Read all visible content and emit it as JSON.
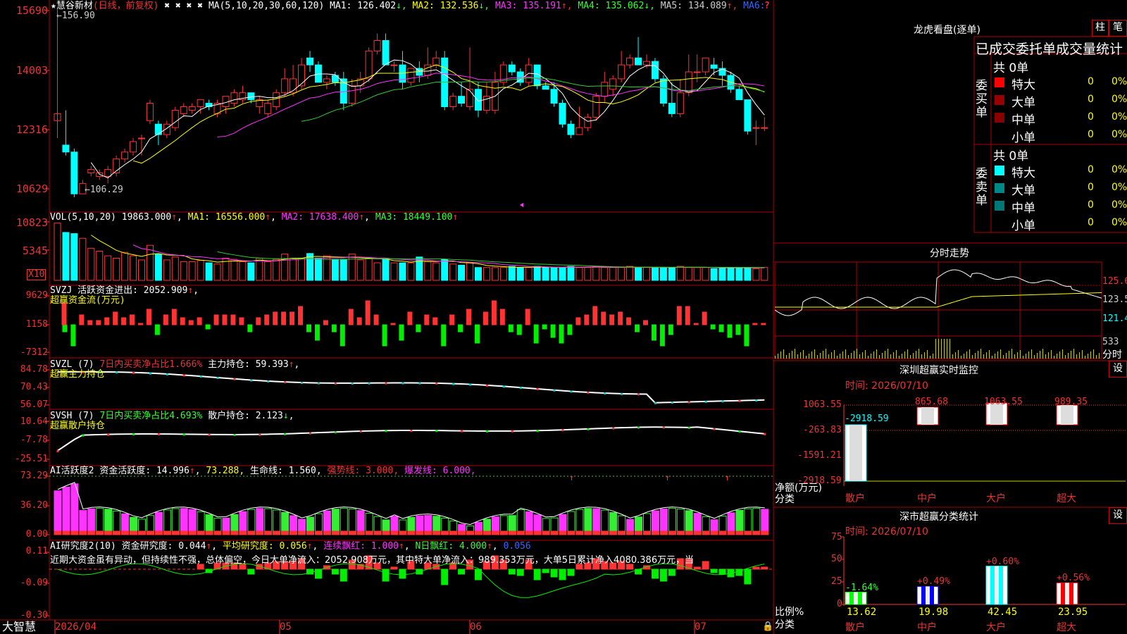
{
  "chart": {
    "stock_name": "慧谷新材",
    "period_note": "(日线，前复权)",
    "ma_header": "MA(5,10,20,30,60,120)",
    "ma_values": [
      {
        "label": "MA1: 126.402",
        "arrow": "↓",
        "color": "#ffffff"
      },
      {
        "label": "MA2: 132.536",
        "arrow": "↓",
        "color": "#ffff00"
      },
      {
        "label": "MA3: 135.191",
        "arrow": "↑",
        "color": "#ff33ff"
      },
      {
        "label": "MA4: 135.062",
        "arrow": "↓",
        "color": "#33ff33"
      },
      {
        "label": "MA5: 134.089",
        "arrow": "↑",
        "color": "#cccccc"
      },
      {
        "label": "MA6:",
        "arrow": "",
        "color": "#3366ff"
      }
    ],
    "high_note": "156.90",
    "low_note": "←106.29",
    "y_ticks": [
      "15690",
      "14003",
      "12316",
      "10629"
    ],
    "candles": [
      [
        125,
        127,
        120,
        128
      ],
      [
        118,
        116,
        115,
        128
      ],
      [
        116,
        104,
        103,
        117
      ],
      [
        104,
        107,
        104,
        108
      ],
      [
        110,
        111,
        109,
        112
      ],
      [
        109,
        110,
        108,
        111
      ],
      [
        109,
        111,
        107,
        112
      ],
      [
        110,
        114,
        109,
        115
      ],
      [
        114,
        116,
        113,
        117
      ],
      [
        116,
        119,
        115,
        120
      ],
      [
        120,
        120,
        115,
        121
      ],
      [
        125,
        130,
        124,
        131
      ],
      [
        124,
        121,
        118,
        125
      ],
      [
        121,
        124,
        120,
        125
      ],
      [
        123,
        128,
        122,
        129
      ],
      [
        127,
        129,
        126,
        130
      ],
      [
        128,
        129,
        127,
        130
      ],
      [
        129,
        131,
        127,
        131
      ],
      [
        130,
        129,
        128,
        131
      ],
      [
        127,
        130,
        126,
        131
      ],
      [
        129,
        132,
        127,
        132
      ],
      [
        130,
        133,
        129,
        134
      ],
      [
        131,
        133,
        130,
        135
      ],
      [
        133,
        131,
        130,
        133
      ],
      [
        129,
        131,
        127,
        132
      ],
      [
        127,
        130,
        126,
        131
      ],
      [
        129,
        133,
        128,
        134
      ],
      [
        133,
        137,
        132,
        140
      ],
      [
        133,
        137,
        132,
        141
      ],
      [
        135,
        141,
        134,
        143
      ],
      [
        143,
        141,
        139,
        145
      ],
      [
        141,
        136,
        136,
        142
      ],
      [
        136,
        137,
        134,
        138
      ],
      [
        138,
        136,
        135,
        139
      ],
      [
        137,
        130,
        128,
        139
      ],
      [
        130,
        135,
        129,
        137
      ],
      [
        135,
        137,
        133,
        139
      ],
      [
        137,
        145,
        136,
        146
      ],
      [
        145,
        148,
        144,
        150
      ],
      [
        148,
        141,
        141,
        150
      ],
      [
        141,
        141,
        139,
        142
      ],
      [
        141,
        136,
        134,
        145
      ],
      [
        136,
        140,
        135,
        140
      ],
      [
        140,
        138,
        136,
        142
      ],
      [
        138,
        141,
        137,
        146
      ],
      [
        141,
        143,
        140,
        145
      ],
      [
        143,
        129,
        128,
        145
      ],
      [
        129,
        132,
        128,
        133
      ],
      [
        132,
        130,
        129,
        136
      ],
      [
        129,
        134,
        128,
        146
      ],
      [
        134,
        128,
        126,
        136
      ],
      [
        128,
        132,
        127,
        136
      ],
      [
        128,
        136,
        127,
        139
      ],
      [
        136,
        141,
        135,
        142
      ],
      [
        141,
        139,
        138,
        142
      ],
      [
        139,
        136,
        135,
        140
      ],
      [
        136,
        141,
        135,
        143
      ],
      [
        141,
        135,
        134,
        141
      ],
      [
        135,
        134,
        134,
        136
      ],
      [
        134,
        130,
        129,
        136
      ],
      [
        130,
        124,
        123,
        131
      ],
      [
        124,
        121,
        120,
        125
      ],
      [
        121,
        123,
        121,
        129
      ],
      [
        123,
        126,
        122,
        127
      ],
      [
        126,
        132,
        125,
        133
      ],
      [
        132,
        136,
        130,
        139
      ],
      [
        134,
        137,
        132,
        138
      ],
      [
        137,
        141,
        136,
        145
      ],
      [
        141,
        143,
        140,
        144
      ],
      [
        143,
        141,
        141,
        149
      ],
      [
        141,
        142,
        140,
        144
      ],
      [
        142,
        137,
        136,
        143
      ],
      [
        137,
        130,
        129,
        138
      ],
      [
        130,
        127,
        126,
        136
      ],
      [
        127,
        133,
        126,
        137
      ],
      [
        133,
        139,
        132,
        144
      ],
      [
        139,
        139,
        136,
        144
      ],
      [
        139,
        143,
        138,
        143
      ],
      [
        141,
        140,
        138,
        143
      ],
      [
        140,
        138,
        135,
        142
      ],
      [
        138,
        134,
        133,
        139
      ],
      [
        134,
        131,
        131,
        135
      ],
      [
        131,
        122,
        121,
        131
      ],
      [
        123,
        123,
        118,
        125
      ],
      [
        123,
        123,
        122,
        126
      ]
    ],
    "bottom_dates": [
      "2026/04",
      "05",
      "06",
      "07"
    ],
    "brand": "大智慧"
  },
  "vol": {
    "header": "VOL(5,10,20)",
    "v": "19863.000",
    "ma1": "MA1: 16556.000",
    "ma2": "MA2: 17638.400",
    "ma3": "MA3: 18449.100",
    "y_ticks": [
      "10823",
      "5345"
    ],
    "unit": "X10",
    "bars": [
      0.98,
      0.82,
      0.8,
      0.72,
      0.55,
      0.5,
      0.42,
      0.38,
      0.48,
      0.42,
      0.35,
      0.6,
      0.45,
      0.35,
      0.4,
      0.32,
      0.32,
      0.34,
      0.3,
      0.28,
      0.38,
      0.36,
      0.32,
      0.3,
      0.38,
      0.32,
      0.36,
      0.45,
      0.38,
      0.38,
      0.46,
      0.38,
      0.42,
      0.36,
      0.36,
      0.45,
      0.35,
      0.38,
      0.3,
      0.36,
      0.3,
      0.3,
      0.3,
      0.4,
      0.32,
      0.3,
      0.36,
      0.28,
      0.26,
      0.3,
      0.22,
      0.22,
      0.22,
      0.22,
      0.24,
      0.22,
      0.22,
      0.24,
      0.22,
      0.22,
      0.22,
      0.24,
      0.22,
      0.22,
      0.24,
      0.22,
      0.22,
      0.22,
      0.24,
      0.22,
      0.22,
      0.22,
      0.22,
      0.22,
      0.24,
      0.22,
      0.22,
      0.22,
      0.2,
      0.22,
      0.22,
      0.22,
      0.22,
      0.2,
      0.22
    ]
  },
  "svzj": {
    "header": "SVZJ",
    "label": "活跃资金进出:",
    "value": "2052.909",
    "subtitle": "超赢资金流(万元)",
    "y_ticks": [
      "9629",
      "1158",
      "-7312"
    ]
  },
  "svzl": {
    "header": "SVZL (7)",
    "pct": "7日内买卖净占比1.666%",
    "hold": "主力持仓: 59.393",
    "subtitle": "超赢主力持仓",
    "y_ticks": [
      "84.78",
      "70.43",
      "56.07"
    ]
  },
  "svsh": {
    "header": "SVSH (7)",
    "pct": "7日内买卖净占比4.693%",
    "hold": "散户持仓: 2.123",
    "subtitle": "超赢散户持仓",
    "y_ticks": [
      "10.64",
      "-7.78",
      "-25.51"
    ]
  },
  "ai1": {
    "header": "AI活跃度2",
    "a": "资金活跃度: 14.996",
    "b": "73.288,",
    "c": "生命线: 1.560,",
    "d": "强势线: 3.000,",
    "e": "爆发线: 6.000,",
    "y_ticks": [
      "73.29",
      "36.20",
      "0.00"
    ]
  },
  "ai2": {
    "header": "AI研究度2(10)",
    "a": "资金研究度: 0.044",
    "b": "平均研究度: 0.056",
    "c": "连续飘红: 1.000",
    "d": "N日飘红: 4.000",
    "e": "0.056",
    "comment": "近期大资金虽有异动，但持续性不强，总体偏空，今日大单净流入：2052.908万元，其中特大单净流入：989.353万元，大单5日累计净入4080.386万元，当",
    "y_ticks": [
      "0.11",
      "-0.09",
      "-0.30"
    ]
  },
  "right": {
    "lhb_title": "龙虎看盘(逐单)",
    "btn1": "柱",
    "btn2": "笔",
    "tabs_title": "已成交委托单成交量统计",
    "buy_side": "委买单",
    "sell_side": "委卖单",
    "buy_total": "共 0单",
    "sell_total": "共 0单",
    "rows": [
      "特大",
      "大单",
      "中单",
      "小单"
    ],
    "zero": "0",
    "pct": "0%",
    "fenshi_title": "分时走势",
    "fenshi_y": [
      "125.6",
      "123.5",
      "121.4"
    ],
    "fenshi_vol": "533",
    "fenshi_unit": "分时",
    "sz_title": "深圳超赢实时监控",
    "sz_btn": "设",
    "sz_time": "时间: 2026/07/10",
    "sz_y": [
      "1063.55",
      "-263.83",
      "-1591.21",
      "-2918.59"
    ],
    "sz_bars": [
      {
        "label": "散户",
        "value": "-2918.59"
      },
      {
        "label": "中户",
        "value": "865.68"
      },
      {
        "label": "大户",
        "value": "1063.55"
      },
      {
        "label": "超大",
        "value": "989.35"
      }
    ],
    "sz_ylabel": "净额(万元)",
    "sz_xlabel": "分类",
    "cls_title": "深市超赢分类统计",
    "cls_btn": "设",
    "cls_time": "时间: 2026/07/10",
    "cls_y": [
      "75",
      "50",
      "25",
      "0"
    ],
    "cls_bars": [
      {
        "label": "散户",
        "pct": "-1.64%",
        "value": "13.62",
        "color": "#00ff00"
      },
      {
        "label": "中户",
        "pct": "+0.49%",
        "value": "19.98",
        "color": "#0000ff"
      },
      {
        "label": "大户",
        "pct": "+0.60%",
        "value": "42.45",
        "color": "#00ffff"
      },
      {
        "label": "超大",
        "pct": "+0.56%",
        "value": "23.95",
        "color": "#ff0000"
      }
    ],
    "cls_ylabel": "比例%",
    "cls_xlabel": "分类"
  }
}
